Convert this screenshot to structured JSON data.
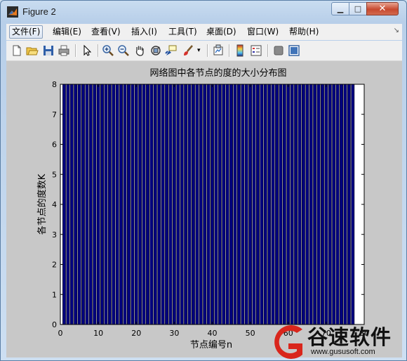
{
  "window": {
    "title": "Figure 2"
  },
  "menu": {
    "items": [
      {
        "label": "文件(F)"
      },
      {
        "label": "编辑(E)"
      },
      {
        "label": "查看(V)"
      },
      {
        "label": "插入(I)"
      },
      {
        "label": "工具(T)"
      },
      {
        "label": "桌面(D)"
      },
      {
        "label": "窗口(W)"
      },
      {
        "label": "帮助(H)"
      }
    ]
  },
  "toolbar": {
    "icons": [
      "new-figure-icon",
      "open-file-icon",
      "save-icon",
      "print-icon",
      "edit-plot-arrow-icon",
      "zoom-in-icon",
      "zoom-out-icon",
      "pan-hand-icon",
      "rotate-3d-icon",
      "data-cursor-icon",
      "brush-icon",
      "brush-dropdown-icon",
      "link-plot-icon",
      "colorbar-icon",
      "legend-icon",
      "hide-plot-tools-icon",
      "show-plot-tools-icon"
    ]
  },
  "chart_data": {
    "type": "bar",
    "title": "网络图中各节点的度的大小分布图",
    "xlabel": "节点编号n",
    "ylabel": "各节点的度数K",
    "xlim": [
      0,
      80
    ],
    "ylim": [
      0,
      8
    ],
    "xticks": [
      "0",
      "10",
      "20",
      "30",
      "40",
      "50",
      "60",
      "70",
      "80"
    ],
    "yticks": [
      "0",
      "1",
      "2",
      "3",
      "4",
      "5",
      "6",
      "7",
      "8"
    ],
    "x": [
      1,
      2,
      3,
      4,
      5,
      6,
      7,
      8,
      9,
      10,
      11,
      12,
      13,
      14,
      15,
      16,
      17,
      18,
      19,
      20,
      21,
      22,
      23,
      24,
      25,
      26,
      27,
      28,
      29,
      30,
      31,
      32,
      33,
      34,
      35,
      36,
      37,
      38,
      39,
      40,
      41,
      42,
      43,
      44,
      45,
      46,
      47,
      48,
      49,
      50,
      51,
      52,
      53,
      54,
      55,
      56,
      57,
      58,
      59,
      60,
      61,
      62,
      63,
      64,
      65,
      66,
      67,
      68,
      69,
      70,
      71,
      72,
      73,
      74,
      75,
      76,
      77
    ],
    "values": [
      8,
      8,
      8,
      8,
      8,
      8,
      8,
      8,
      8,
      8,
      8,
      8,
      8,
      8,
      8,
      8,
      8,
      8,
      8,
      8,
      8,
      8,
      8,
      8,
      8,
      8,
      8,
      8,
      8,
      8,
      8,
      8,
      8,
      8,
      8,
      8,
      8,
      8,
      8,
      8,
      8,
      8,
      8,
      8,
      8,
      8,
      8,
      8,
      8,
      8,
      8,
      8,
      8,
      8,
      8,
      8,
      8,
      8,
      8,
      8,
      8,
      8,
      8,
      8,
      8,
      8,
      8,
      8,
      8,
      8,
      8,
      8,
      8,
      8,
      8,
      8,
      8
    ],
    "bar_color": "#00007f",
    "edge_color": "#000000",
    "background": "#ffffff",
    "grid": false,
    "box": true
  },
  "watermark": {
    "brand": "谷速软件",
    "url": "www.gususoft.com",
    "color": "#d9261c"
  }
}
